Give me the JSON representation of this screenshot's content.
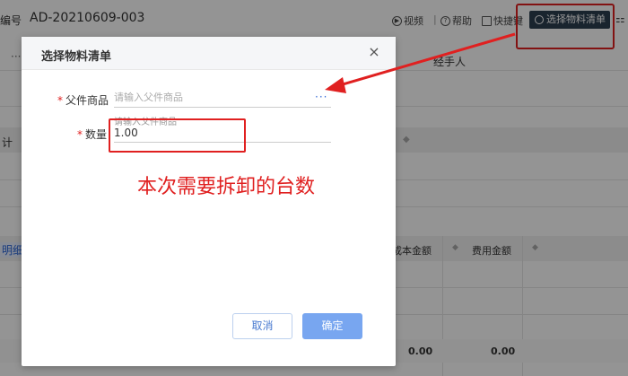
{
  "header": {
    "doc_label": "编号",
    "doc_number": "AD-20210609-003",
    "video_label": "视频",
    "help_label": "帮助",
    "shortcut_label": "快捷键",
    "select_material_label": "选择物料清单",
    "separator": "|"
  },
  "background": {
    "tab_overflow": "···",
    "handler_label": "经手人",
    "plan_label": "计",
    "detail_tab": "明细",
    "columns": [
      "成本金额",
      "费用金额"
    ],
    "totals": [
      "0.00",
      "0.00"
    ]
  },
  "dialog": {
    "title": "选择物料清单",
    "close_symbol": "×",
    "parent_product": {
      "label": "父件商品",
      "placeholder": "请输入父件商品",
      "value": "",
      "more": "···"
    },
    "quantity": {
      "label": "数量",
      "placeholder": "请输入父件商品",
      "value": "1.00"
    },
    "cancel_label": "取消",
    "confirm_label": "确定"
  },
  "annotation": {
    "text": "本次需要拆卸的台数",
    "color": "#e02020"
  },
  "colors": {
    "primary_button": "#78a6f0",
    "dark_button": "#2c3e50",
    "annotation_red": "#e02020"
  }
}
